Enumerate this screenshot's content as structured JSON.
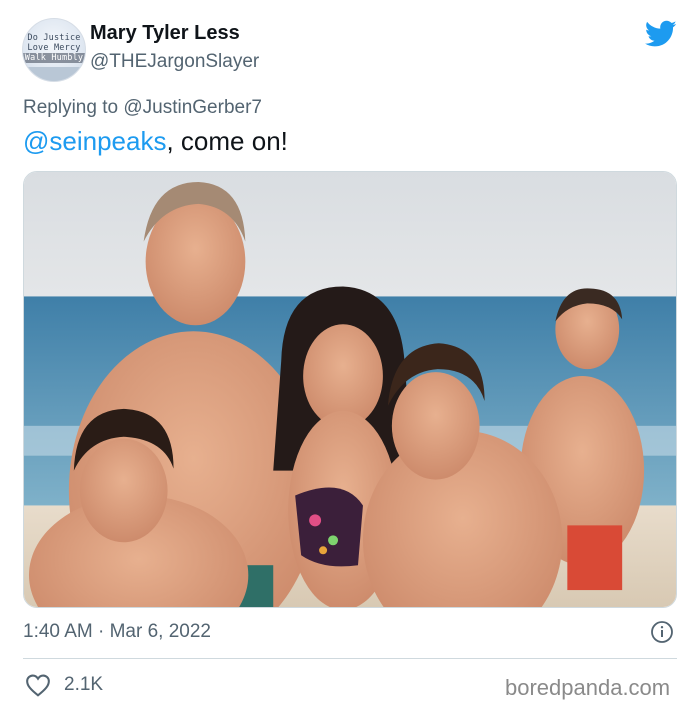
{
  "author": {
    "avatar_lines": [
      "Do Justice",
      "Love Mercy",
      "Walk Humbly"
    ],
    "name": "Mary Tyler Less",
    "handle": "@THEJargonSlayer"
  },
  "reply": {
    "prefix": "Replying to ",
    "to": "@JustinGerber7"
  },
  "tweet": {
    "mention": "@seinpeaks",
    "text": ", come on!"
  },
  "meta": {
    "timestamp": "1:40 AM · Mar 6, 2022",
    "likes": "2.1K"
  },
  "watermark": "boredpanda.com",
  "icons": {
    "brand": "twitter-bird-icon",
    "info": "info-icon",
    "like": "heart-icon"
  },
  "colors": {
    "accent": "#1d9bf0",
    "text": "#0f1419",
    "secondary": "#536471"
  }
}
